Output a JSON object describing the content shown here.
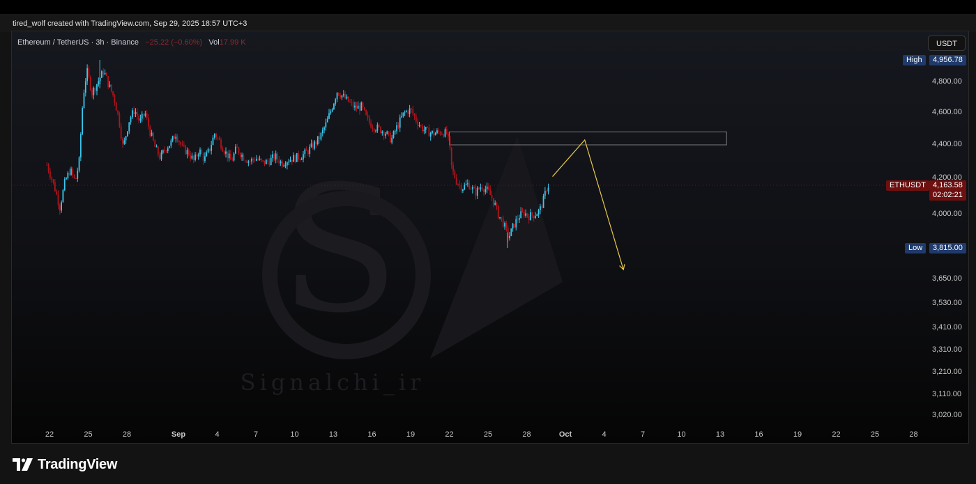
{
  "header": {
    "created_text": "tired_wolf created with TradingView.com, Sep 29, 2025 18:57 UTC+3"
  },
  "legend": {
    "symbol": "Ethereum / TetherUS · 3h · Binance",
    "change": "−25.22 (−0.60%)",
    "vol_label": "Vol",
    "vol_value": "17.99 K"
  },
  "unit_button": "USDT",
  "tags": {
    "high_label": "High",
    "high_value": "4,956.78",
    "low_label": "Low",
    "low_value": "3,815.00",
    "symbol_label": "ETHUSDT",
    "last_price": "4,163.58",
    "countdown": "02:02:21"
  },
  "watermark": {
    "text": "Signalchi_ir"
  },
  "footer": {
    "brand": "TradingView"
  },
  "colors": {
    "up": "#3bc7ec",
    "down": "#b0141a",
    "projection": "#e8c84c",
    "last_price_line": "#6e1010",
    "zone_border": "#7a7a7a"
  },
  "chart_data": {
    "type": "candlestick",
    "symbol": "ETHUSDT",
    "timeframe": "3h",
    "y_scale": "log",
    "ylim": [
      3000,
      5050
    ],
    "price_ticks": [
      "4,800.00",
      "4,600.00",
      "4,400.00",
      "4,200.00",
      "4,000.00",
      "3,650.00",
      "3,530.00",
      "3,410.00",
      "3,310.00",
      "3,210.00",
      "3,110.00",
      "3,020.00"
    ],
    "price_tick_values": [
      4800,
      4600,
      4400,
      4200,
      4000,
      3650,
      3530,
      3410,
      3310,
      3210,
      3110,
      3020
    ],
    "date_ticks": [
      "22",
      "25",
      "28",
      "Sep",
      "4",
      "7",
      "10",
      "13",
      "16",
      "19",
      "22",
      "25",
      "28",
      "Oct",
      "4",
      "7",
      "10",
      "13",
      "16",
      "19",
      "22",
      "25",
      "28"
    ],
    "date_tick_days": [
      0,
      3,
      6,
      10,
      13,
      16,
      19,
      22,
      25,
      28,
      31,
      34,
      37,
      40,
      43,
      46,
      49,
      52,
      55,
      58,
      61,
      64,
      67
    ],
    "price_path": [
      [
        -0.2,
        4280
      ],
      [
        0.4,
        4150
      ],
      [
        0.8,
        4040
      ],
      [
        1.2,
        4180
      ],
      [
        1.6,
        4250
      ],
      [
        2.0,
        4180
      ],
      [
        2.3,
        4300
      ],
      [
        2.6,
        4700
      ],
      [
        2.9,
        4880
      ],
      [
        3.3,
        4730
      ],
      [
        3.8,
        4810
      ],
      [
        4.2,
        4880
      ],
      [
        4.6,
        4780
      ],
      [
        5.0,
        4700
      ],
      [
        5.4,
        4550
      ],
      [
        5.7,
        4380
      ],
      [
        6.2,
        4560
      ],
      [
        6.6,
        4620
      ],
      [
        7.0,
        4540
      ],
      [
        7.4,
        4600
      ],
      [
        7.8,
        4480
      ],
      [
        8.2,
        4380
      ],
      [
        8.6,
        4320
      ],
      [
        9.0,
        4380
      ],
      [
        9.4,
        4410
      ],
      [
        9.8,
        4470
      ],
      [
        10.3,
        4380
      ],
      [
        10.8,
        4350
      ],
      [
        11.2,
        4300
      ],
      [
        11.6,
        4370
      ],
      [
        12.0,
        4310
      ],
      [
        12.4,
        4370
      ],
      [
        12.8,
        4470
      ],
      [
        13.2,
        4420
      ],
      [
        13.6,
        4360
      ],
      [
        14.1,
        4300
      ],
      [
        14.5,
        4380
      ],
      [
        15.0,
        4330
      ],
      [
        15.5,
        4300
      ],
      [
        16.0,
        4320
      ],
      [
        16.5,
        4290
      ],
      [
        17.0,
        4300
      ],
      [
        17.5,
        4330
      ],
      [
        18.0,
        4290
      ],
      [
        18.5,
        4310
      ],
      [
        19.0,
        4320
      ],
      [
        19.5,
        4330
      ],
      [
        20.0,
        4360
      ],
      [
        20.5,
        4400
      ],
      [
        21.0,
        4450
      ],
      [
        21.5,
        4540
      ],
      [
        22.0,
        4660
      ],
      [
        22.3,
        4740
      ],
      [
        22.7,
        4710
      ],
      [
        23.2,
        4670
      ],
      [
        23.7,
        4630
      ],
      [
        24.2,
        4640
      ],
      [
        24.6,
        4560
      ],
      [
        25.0,
        4520
      ],
      [
        25.5,
        4500
      ],
      [
        26.0,
        4480
      ],
      [
        26.5,
        4430
      ],
      [
        27.0,
        4520
      ],
      [
        27.5,
        4600
      ],
      [
        28.0,
        4620
      ],
      [
        28.4,
        4560
      ],
      [
        28.8,
        4510
      ],
      [
        29.3,
        4480
      ],
      [
        29.8,
        4470
      ],
      [
        30.3,
        4480
      ],
      [
        30.8,
        4470
      ],
      [
        31.0,
        4400
      ],
      [
        31.2,
        4250
      ],
      [
        31.6,
        4180
      ],
      [
        32.0,
        4150
      ],
      [
        32.5,
        4170
      ],
      [
        33.0,
        4120
      ],
      [
        33.5,
        4160
      ],
      [
        34.0,
        4130
      ],
      [
        34.4,
        4080
      ],
      [
        34.8,
        4000
      ],
      [
        35.2,
        3950
      ],
      [
        35.6,
        3870
      ],
      [
        36.0,
        3940
      ],
      [
        36.4,
        3990
      ],
      [
        36.8,
        4010
      ],
      [
        37.2,
        3990
      ],
      [
        37.6,
        4000
      ],
      [
        38.0,
        4020
      ],
      [
        38.3,
        4080
      ],
      [
        38.6,
        4160
      ],
      [
        38.75,
        4163.58
      ]
    ],
    "high_point": {
      "day": 3.9,
      "price": 4956.78
    },
    "low_point": {
      "day": 35.5,
      "price": 3815.0
    },
    "last_price": 4163.58,
    "resistance_zone": {
      "day_from": 31.0,
      "day_to": 52.5,
      "price_low": 4400,
      "price_high": 4480
    },
    "projection": [
      [
        39.0,
        4210
      ],
      [
        41.5,
        4430
      ],
      [
        44.5,
        3700
      ]
    ]
  }
}
